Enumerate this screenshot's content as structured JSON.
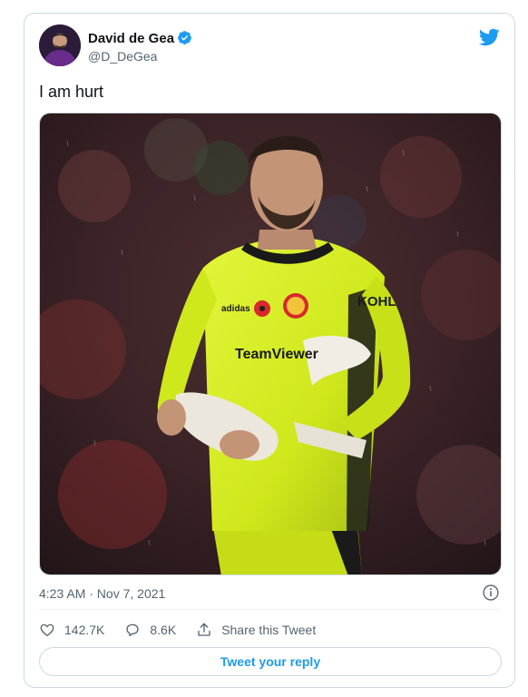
{
  "author": {
    "name": "David de Gea",
    "handle": "@D_DeGea",
    "verified": true
  },
  "tweet": {
    "text": "I am hurt",
    "timestamp": "4:23 AM · Nov 7, 2021"
  },
  "media": {
    "jersey_sponsor": "TeamViewer",
    "sleeve_sponsor": "KOHL"
  },
  "actions": {
    "likes": "142.7K",
    "replies": "8.6K",
    "share_label": "Share this Tweet"
  },
  "reply_button_label": "Tweet your reply",
  "colors": {
    "twitter_blue": "#1d9bf0",
    "text_primary": "#0f1419",
    "text_secondary": "#536471",
    "border": "#cfd9de",
    "jersey_yellow": "#d6f01e"
  },
  "icons": [
    "verified-badge-icon",
    "twitter-bird-icon",
    "info-icon",
    "heart-icon",
    "reply-bubble-icon",
    "share-icon"
  ]
}
